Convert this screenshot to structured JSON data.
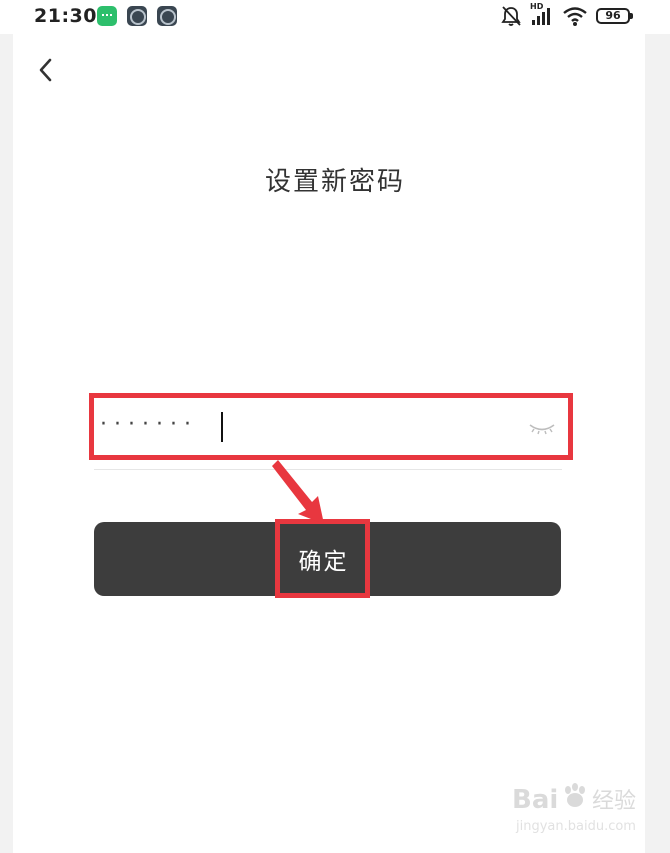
{
  "status_bar": {
    "time": "21:30",
    "hd_label": "HD",
    "battery_level": "96",
    "notification_icons": [
      "message-app-icon",
      "app-icon",
      "app-icon"
    ],
    "system_icons": [
      "silent-bell-icon",
      "cellular-signal-icon",
      "wifi-icon",
      "battery-icon"
    ]
  },
  "header": {
    "back_icon": "chevron-left-icon"
  },
  "page": {
    "title": "设置新密码"
  },
  "password": {
    "masked_value": "·······",
    "visibility_icon": "eye-closed-icon"
  },
  "confirm": {
    "label": "确定"
  },
  "annotations": {
    "highlight_color": "#e8373f"
  },
  "colors": {
    "button_bg": "#3d3d3d",
    "page_bg": "#ffffff",
    "title_text": "#333333"
  }
}
